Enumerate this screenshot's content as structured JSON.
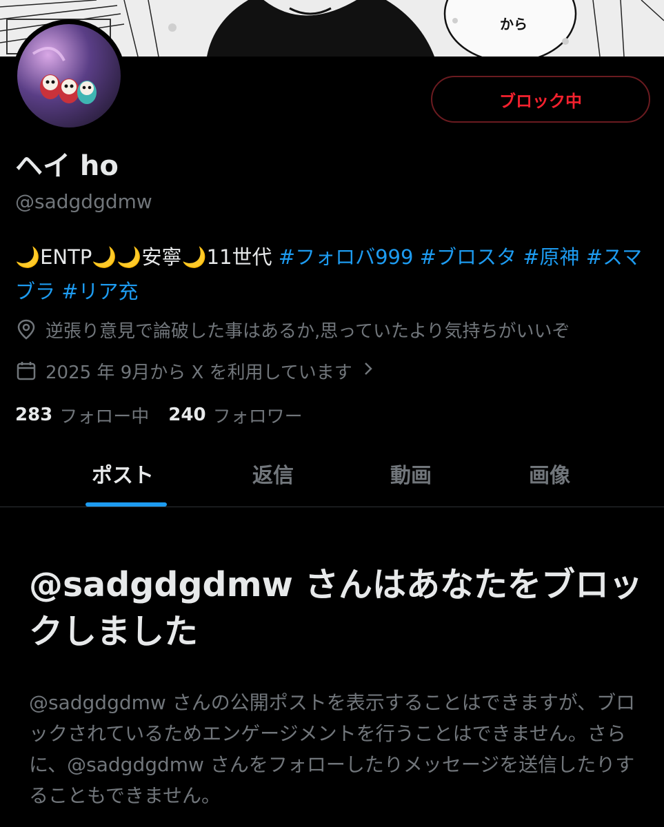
{
  "header": {
    "banner_text": "から",
    "blocking_button_label": "ブロック中"
  },
  "profile": {
    "display_name": "ヘイ ho",
    "handle": "@sadgdgdmw",
    "bio": {
      "plain": "🌙ENTP🌙🌙安寧🌙11世代 ",
      "tags": [
        "#フォロバ999",
        "#ブロスタ",
        "#原神",
        "#スマブラ",
        "#リア充"
      ]
    },
    "location": "逆張り意見で論破した事はあるか,思っていたより気持ちがいいぞ",
    "joined": "2025 年 9月から X を利用しています",
    "following_count": "283",
    "following_label": "フォロー中",
    "followers_count": "240",
    "followers_label": "フォロワー"
  },
  "tabs": [
    {
      "label": "ポスト",
      "active": true
    },
    {
      "label": "返信",
      "active": false
    },
    {
      "label": "動画",
      "active": false
    },
    {
      "label": "画像",
      "active": false
    }
  ],
  "blocked_notice": {
    "title": "@sadgdgdmw さんはあなたをブロックしました",
    "body": "@sadgdgdmw さんの公開ポストを表示することはできますが、ブロックされているためエンゲージメントを行うことはできません。さらに、@sadgdgdmw さんをフォローしたりメッセージを送信したりすることもできません。"
  },
  "colors": {
    "background": "#000000",
    "accent": "#1d9bf0",
    "danger": "#f4212e",
    "secondary_text": "#71767b",
    "primary_text": "#e7e9ea"
  },
  "icons": [
    "location-pin-icon",
    "calendar-icon",
    "chevron-right-icon"
  ]
}
